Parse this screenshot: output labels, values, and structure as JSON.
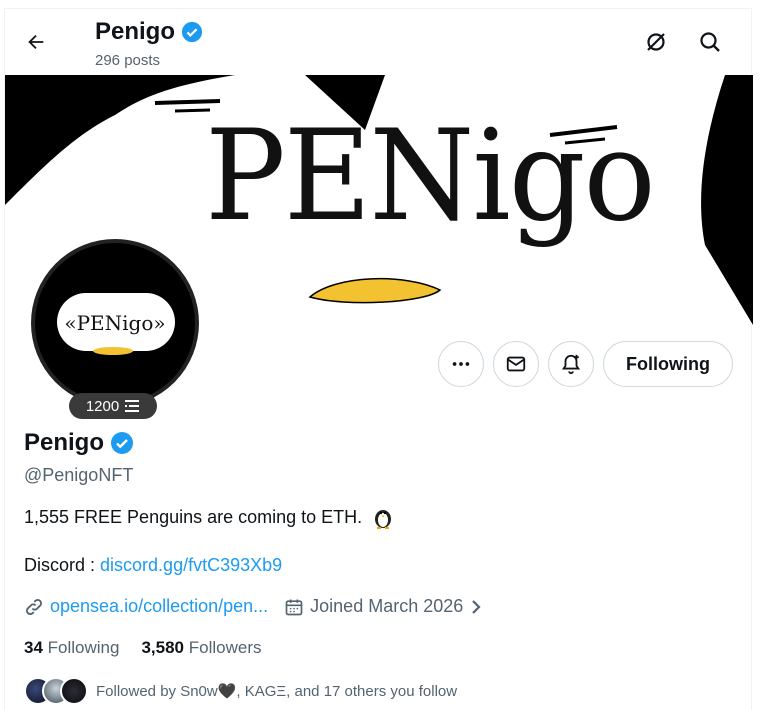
{
  "header": {
    "title": "Penigo",
    "posts": "296 posts"
  },
  "banner": {
    "word": "PENigo"
  },
  "avatar": {
    "word": "«PENigo»",
    "badge_count": "1200"
  },
  "actions": {
    "follow_label": "Following"
  },
  "profile": {
    "name": "Penigo",
    "handle": "@PenigoNFT",
    "bio": "1,555 FREE Penguins are coming to ETH.",
    "discord_label": "Discord : ",
    "discord_link": "discord.gg/fvtC393Xb9",
    "website": "opensea.io/collection/pen...",
    "joined": "Joined March 2026"
  },
  "stats": {
    "following_count": "34",
    "following_label": "Following",
    "followers_count": "3,580",
    "followers_label": "Followers"
  },
  "followed_by": "Followed by Sn0w🖤, KAGΞ, and 17 others you follow",
  "colors": {
    "accent": "#1d9bf0",
    "verified": "#1d9bf0",
    "text": "#0f1419",
    "muted": "#536471",
    "beak": "#f2c230"
  }
}
